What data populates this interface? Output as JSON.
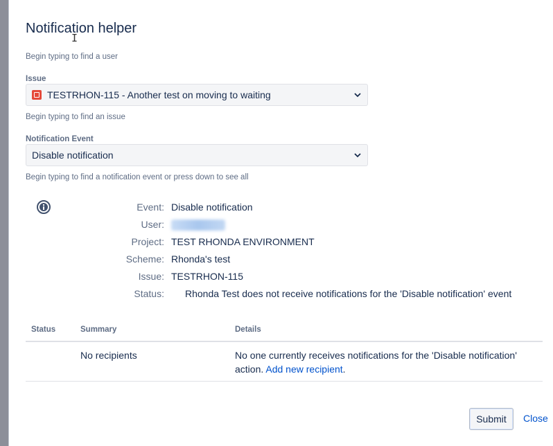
{
  "dialog": {
    "title": "Notification helper"
  },
  "user_field": {
    "hint": "Begin typing to find a user"
  },
  "issue_field": {
    "label": "Issue",
    "value": "TESTRHON-115 - Another test on moving to waiting",
    "hint": "Begin typing to find an issue",
    "icon": "issue-type-icon",
    "icon_color": "#e5493a"
  },
  "event_field": {
    "label": "Notification Event",
    "value": "Disable notification",
    "hint": "Begin typing to find a notification event or press down to see all"
  },
  "details": {
    "icon": "info-icon",
    "rows": [
      {
        "label": "Event:",
        "value": "Disable notification"
      },
      {
        "label": "User:",
        "value": ""
      },
      {
        "label": "Project:",
        "value": "TEST RHONDA ENVIRONMENT"
      },
      {
        "label": "Scheme:",
        "value": "Rhonda's test"
      },
      {
        "label": "Issue:",
        "value": "TESTRHON-115"
      },
      {
        "label": "Status:",
        "value": "Rhonda Test does not receive notifications for the 'Disable notification' event"
      }
    ]
  },
  "table": {
    "headers": [
      "Status",
      "Summary",
      "Details"
    ],
    "row": {
      "status": "",
      "summary": "No recipients",
      "details_text": "No one currently receives notifications for the 'Disable notification'",
      "details_text2": "action.",
      "details_link": "Add new recipient",
      "details_end": "."
    }
  },
  "actions": {
    "submit": "Submit",
    "close": "Close"
  },
  "colors": {
    "link": "#0052cc",
    "text": "#172b4d",
    "muted": "#5e6c84"
  }
}
